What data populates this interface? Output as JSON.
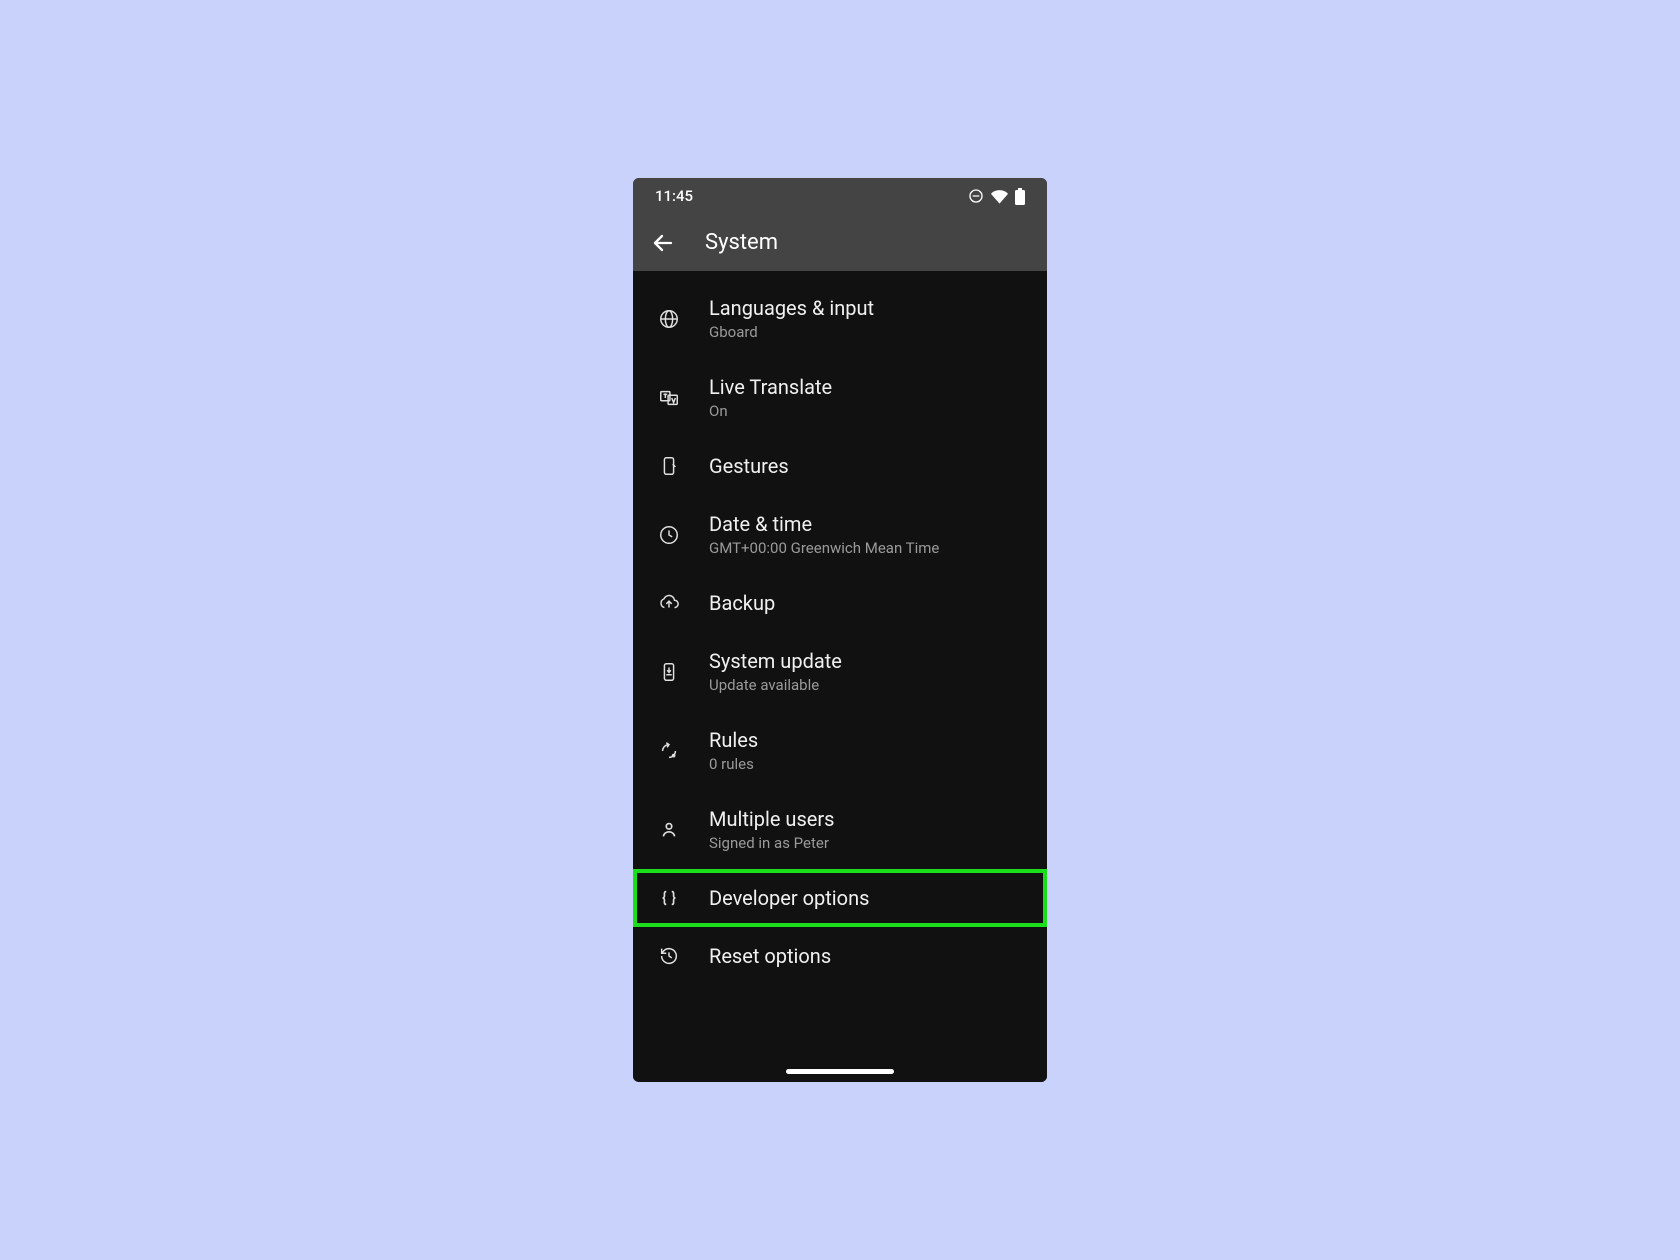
{
  "status": {
    "time": "11:45"
  },
  "header": {
    "title": "System"
  },
  "items": [
    {
      "title": "Languages & input",
      "subtitle": "Gboard"
    },
    {
      "title": "Live Translate",
      "subtitle": "On"
    },
    {
      "title": "Gestures",
      "subtitle": ""
    },
    {
      "title": "Date & time",
      "subtitle": "GMT+00:00 Greenwich Mean Time"
    },
    {
      "title": "Backup",
      "subtitle": ""
    },
    {
      "title": "System update",
      "subtitle": "Update available"
    },
    {
      "title": "Rules",
      "subtitle": "0 rules"
    },
    {
      "title": "Multiple users",
      "subtitle": "Signed in as Peter"
    },
    {
      "title": "Developer options",
      "subtitle": ""
    },
    {
      "title": "Reset options",
      "subtitle": ""
    }
  ]
}
